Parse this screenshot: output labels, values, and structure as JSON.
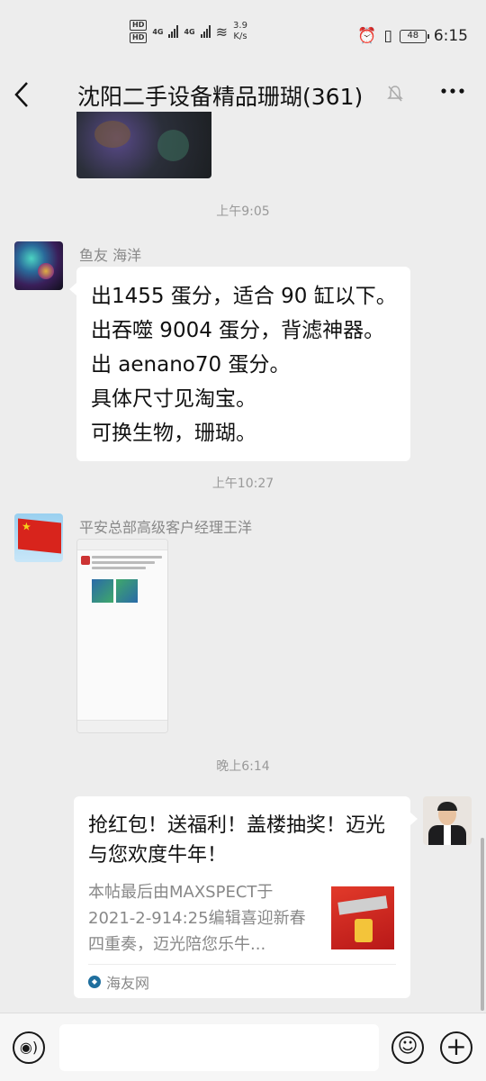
{
  "status_bar": {
    "hd1": "HD",
    "hd2": "HD",
    "net1": "4G",
    "net2": "4G",
    "speed_value": "3.9",
    "speed_unit": "K/s",
    "battery": "48",
    "time": "6:15"
  },
  "header": {
    "back_icon": "chevron-left-icon",
    "title": "沈阳二手设备精品珊瑚(361)",
    "mute_icon": "bell-off-icon",
    "more_icon": "more-icon"
  },
  "messages": {
    "time_1": "上午9:05",
    "sender_1": "鱼友 海洋",
    "text_lines": [
      "出1455 蛋分，适合 90 缸以下。",
      "出吞噬 9004 蛋分，背滤神器。",
      "出 aenano70 蛋分。",
      "具体尺寸见淘宝。",
      "可换生物，珊瑚。"
    ],
    "time_2": "上午10:27",
    "sender_2": "平安总部高级客户经理王洋",
    "time_3": "晚上6:14",
    "link_card": {
      "title": "抢红包！送福利！盖楼抽奖！迈光与您欢度牛年！",
      "description": "本帖最后由MAXSPECT于2021-2-914:25编辑喜迎新春四重奏，迈光陪您乐牛...",
      "source": "海友网"
    }
  },
  "input_bar": {
    "voice_icon": "voice-icon",
    "input_value": "",
    "emoji_icon": "emoji-icon",
    "plus_icon": "plus-icon"
  }
}
